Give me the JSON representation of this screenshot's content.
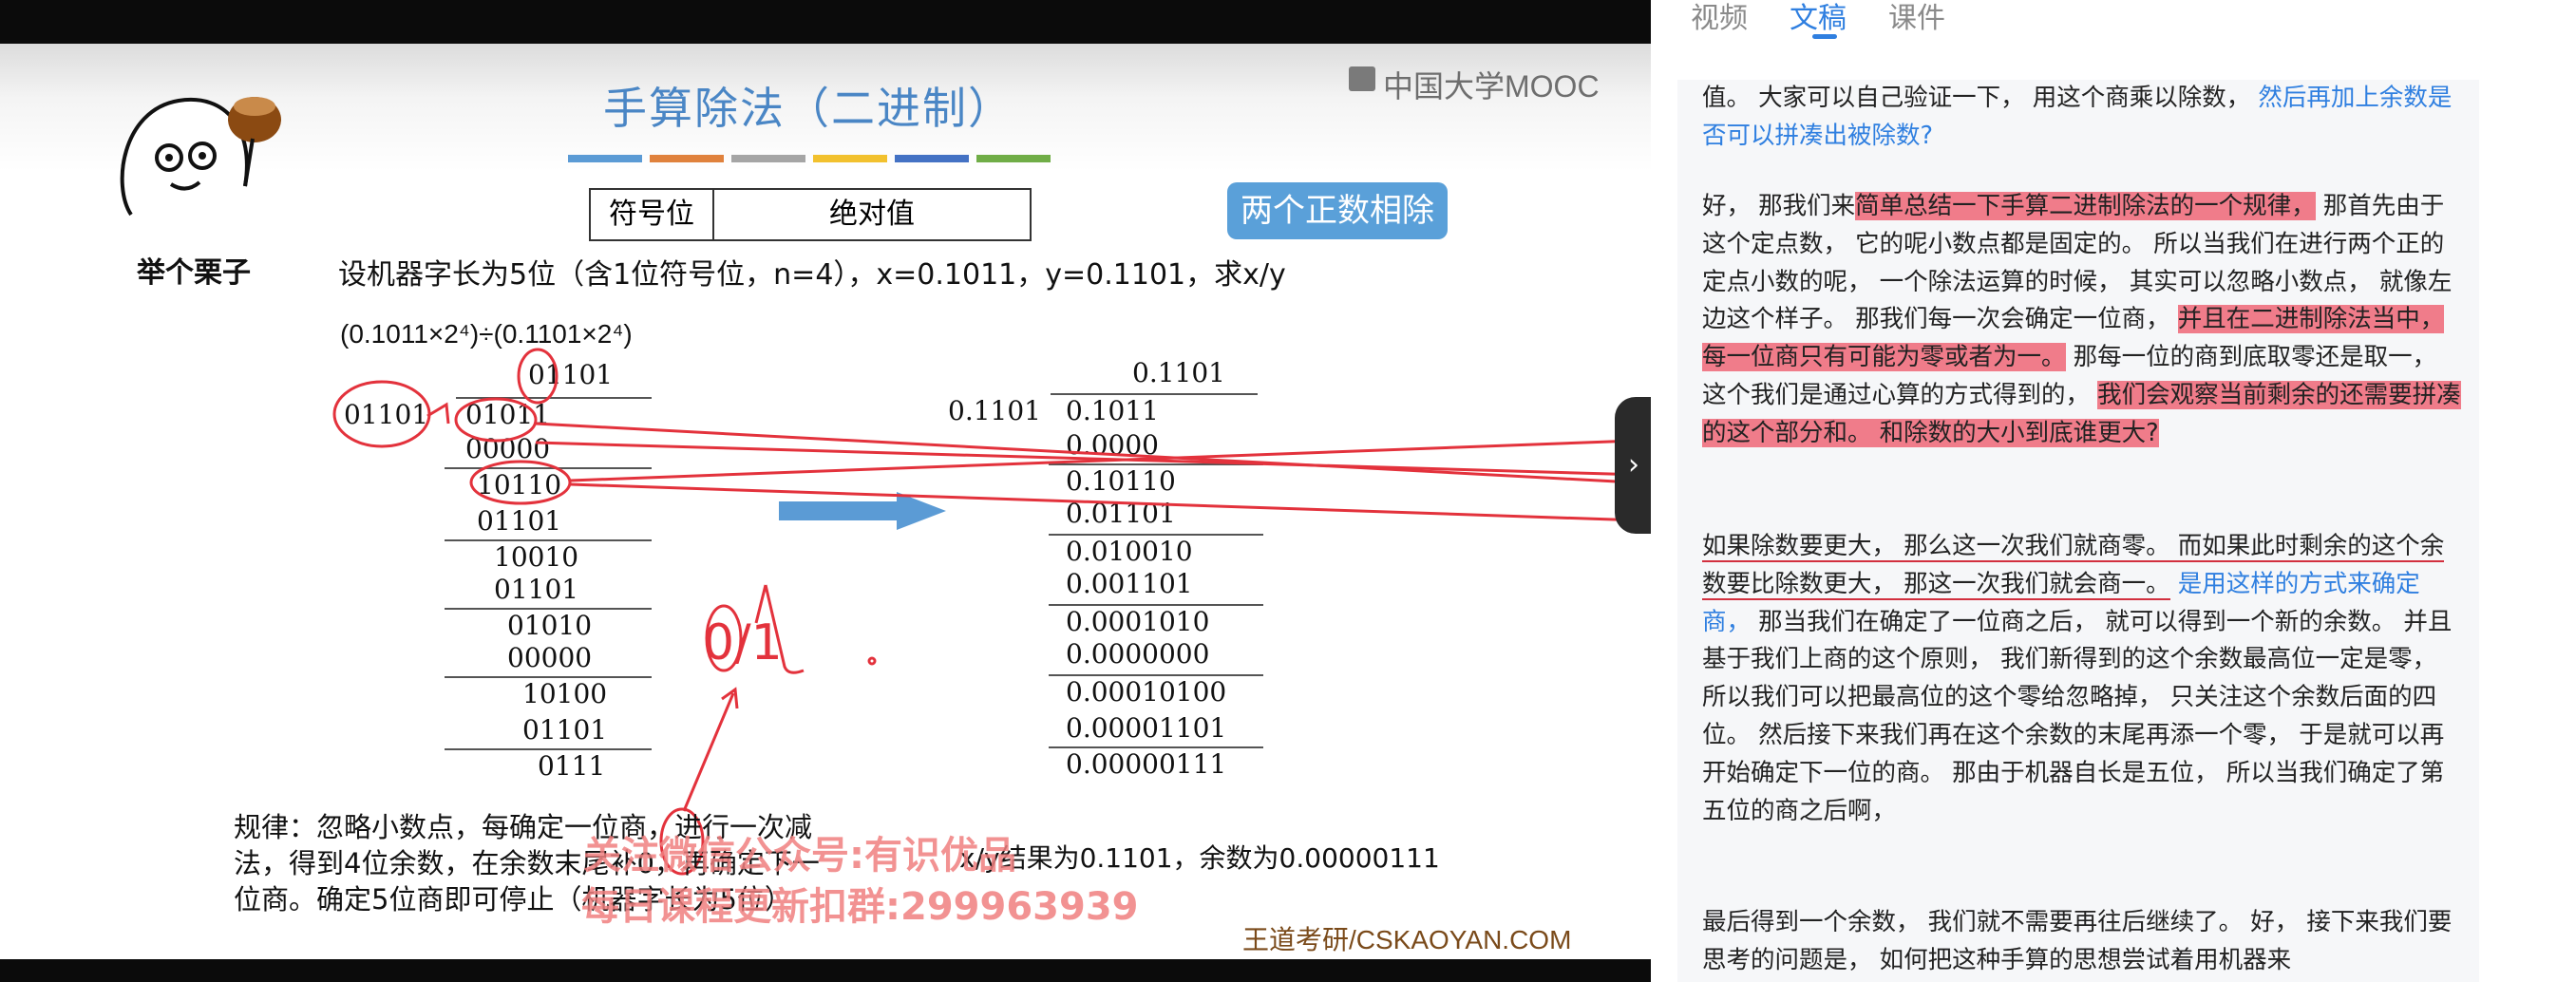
{
  "tabs": [
    "视频",
    "文稿",
    "课件"
  ],
  "slide": {
    "title": "手算除法（二进制）",
    "stripe_colors": [
      "#5b9bd5",
      "#e0823d",
      "#a5a5a5",
      "#f2c12e",
      "#4472c4",
      "#70ad47"
    ],
    "logo_text": "中国大学MOOC",
    "badge": "两个正数相除",
    "sign_table": [
      "符号位",
      "绝对值"
    ],
    "statement": "设机器字长为5位（含1位符号位，n=4），x=0.1011，y=0.1101，求x/y",
    "expression": "(0.1011×2⁴)÷(0.1101×2⁴)",
    "mascot_label": "举个栗子",
    "left_calc": {
      "quotient": "01101",
      "divisor": "01101",
      "lines": [
        "01011",
        "00000",
        "10110",
        "01101",
        "10010",
        "01101",
        "01010",
        "00000",
        "10100",
        "01101",
        "0111"
      ]
    },
    "right_calc": {
      "quotient": "0.1101",
      "divisor": "0.1101",
      "lines": [
        "0.1011",
        "0.0000",
        "0.10110",
        "0.01101",
        "0.010010",
        "0.001101",
        "0.0001010",
        "0.0000000",
        "0.00010100",
        "0.00001101",
        "0.00000111"
      ]
    },
    "annotation": "0/1",
    "rule_lines": [
      "规律：忽略小数点，每确定一位商，进行一次减",
      "法，得到4位余数，在余数末尾补0，再确定下一",
      "位商。确定5位商即可停止（机器字长为5位）"
    ],
    "result": "x/y结果为0.1101，余数为0.00000111",
    "watermark_1": "关注微信公众号:有识优品",
    "watermark_2": "每日课程更新扣群:299963939",
    "brand": "王道考研/CSKAOYAN.COM"
  },
  "transcript": {
    "p1": "值。 大家可以自己验证一下， 用这个商乘以除数， 然后再加上余数是否可以拼凑出被除数?",
    "p1_a": "值。 大家可以自己验证一下， 用这个商乘以除数， ",
    "p1_b": "然后再加上余数是否可以拼凑出被除数?",
    "p2_a": "好， 那我们来",
    "p2_hl1": "简单总结一下手算二进制除法的一个规律，",
    "p2_b": " 那首先由于这个定点数， 它的呢小数点都是固定的。 所以当我们在进行两个正的定点小数的呢， 一个除法运算的时候， 其实可以忽略小数点， 就像左边这个样子。 那我们每一次会确定一位商， ",
    "p2_hl2": "并且在二进制除法当中， 每一位商只有可能为零或者为一。",
    "p2_c": " 那每一位的商到底取零还是取一， 这个我们是通过心算的方式得到的， ",
    "p2_hl3": "我们会观察当前剩余的还需要拼凑的这个部分和。 和除数的大小到底谁更大?",
    "p3_u1": "如果除数要更大， 那么这一次我们就商零。",
    "p3_u2": " 而如果此时剩余的这个余数要比除数更大， 那这一次我们就会商一。",
    "p3_blue": " 是用这样的方式来确定商，",
    "p3_rest": " 那当我们在确定了一位商之后， 就可以得到一个新的余数。 并且基于我们上商的这个原则， 我们新得到的这个余数最高位一定是零， 所以我们可以把最高位的这个零给忽略掉， 只关注这个余数后面的四位。 然后接下来我们再在这个余数的末尾再添一个零， 于是就可以再开始确定下一位的商。 那由于机器自长是五位， 所以当我们确定了第五位的商之后啊，",
    "p4": "最后得到一个余数， 我们就不需要再往后继续了。 好， 接下来我们要思考的问题是， 如何把这种手算的思想尝试着用机器来"
  }
}
